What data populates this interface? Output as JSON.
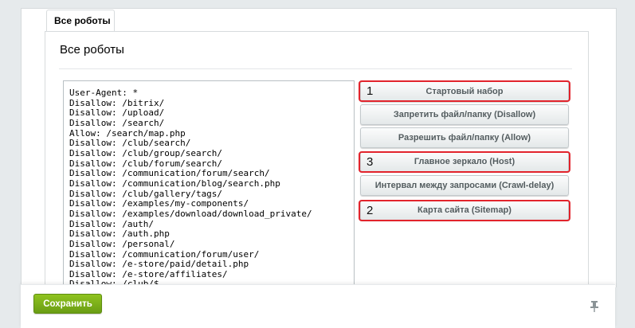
{
  "tab": {
    "label": "Все роботы"
  },
  "page": {
    "title": "Все роботы"
  },
  "robots_txt": "User-Agent: *\nDisallow: /bitrix/\nDisallow: /upload/\nDisallow: /search/\nAllow: /search/map.php\nDisallow: /club/search/\nDisallow: /club/group/search/\nDisallow: /club/forum/search/\nDisallow: /communication/forum/search/\nDisallow: /communication/blog/search.php\nDisallow: /club/gallery/tags/\nDisallow: /examples/my-components/\nDisallow: /examples/download/download_private/\nDisallow: /auth/\nDisallow: /auth.php\nDisallow: /personal/\nDisallow: /communication/forum/user/\nDisallow: /e-store/paid/detail.php\nDisallow: /e-store/affiliates/\nDisallow: /club/$",
  "buttons": {
    "starter_set": "Стартовый набор",
    "disallow": "Запретить файл/папку (Disallow)",
    "allow": "Разрешить файл/папку (Allow)",
    "host": "Главное зеркало (Host)",
    "crawl_delay": "Интервал между запросами (Crawl-delay)",
    "sitemap": "Карта сайта (Sitemap)"
  },
  "annotations": {
    "starter_set": "1",
    "host": "3",
    "sitemap": "2",
    "color": "#e2242c"
  },
  "footer": {
    "save_label": "Сохранить"
  },
  "icons": {
    "pin": "pin-icon"
  }
}
